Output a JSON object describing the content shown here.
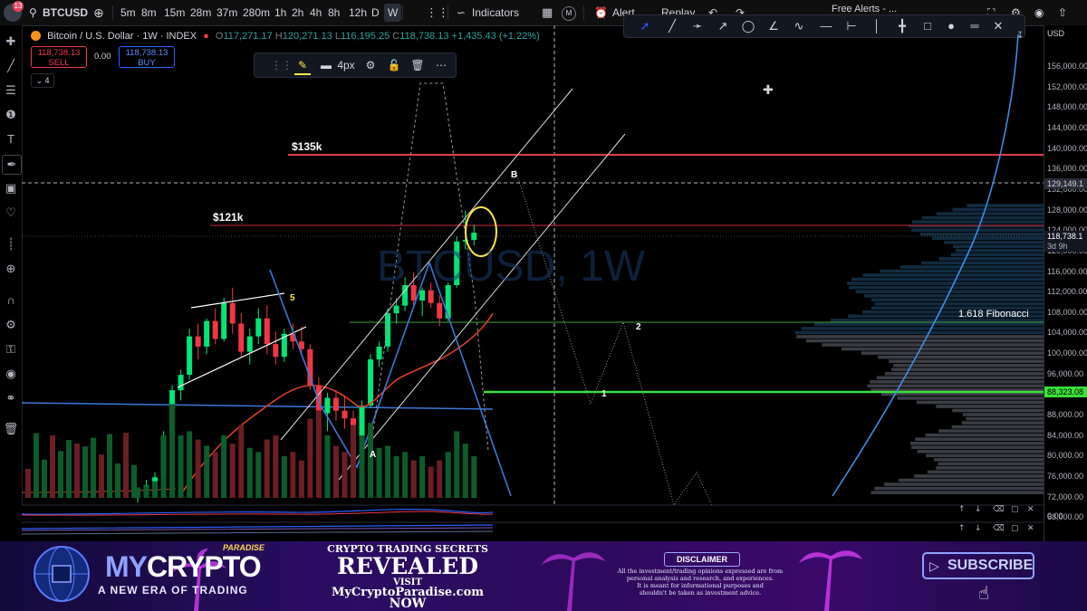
{
  "topbar": {
    "notif_count": "13",
    "symbol": "BTCUSD",
    "intervals": [
      "5m",
      "8m",
      "15m",
      "28m",
      "37m",
      "280m",
      "1h",
      "2h",
      "4h",
      "8h",
      "12h",
      "D",
      "W"
    ],
    "active_interval": "W",
    "indicators_label": "Indicators",
    "alert_label": "Alert",
    "replay_label": "Replay",
    "free_alerts_label": "Free Alerts - ...",
    "m_badge": "M"
  },
  "legend": {
    "title": "Bitcoin / U.S. Dollar · 1W · INDEX",
    "o_label": "O",
    "o_value": "117,271.17",
    "h_label": "H",
    "h_value": "120,271.13",
    "l_label": "L",
    "l_value": "116,195.25",
    "c_label": "C",
    "c_value": "118,738.13",
    "change": "+1,435.43 (+1.22%)"
  },
  "trade": {
    "sell_price": "118,738.13",
    "sell_label": "SELL",
    "spread": "0.00",
    "buy_price": "118,738.13",
    "buy_label": "BUY"
  },
  "collapse_count": "4",
  "linebar": {
    "width_label": "4px"
  },
  "watermark": "BTCUSD, 1W",
  "annotations": {
    "level_135": "$135k",
    "level_121": "$121k",
    "fib": "1.618 Fibonacci",
    "wave_5": "5",
    "wave_a": "A",
    "wave_b": "B",
    "wave_1": "1",
    "wave_2": "2"
  },
  "price_axis": {
    "currency": "USD",
    "ticks": [
      "156,000.00",
      "152,000.00",
      "148,000.00",
      "144,000.00",
      "140,000.00",
      "136,000.00",
      "132,000.00",
      "128,000.00",
      "124,000.00",
      "120,000.00",
      "116,000.00",
      "112,000.00",
      "108,000.00",
      "104,000.00",
      "100,000.00",
      "96,000.00",
      "92,000.00",
      "88,000.00",
      "84,000.00",
      "80,000.00",
      "76,000.00",
      "72,000.00",
      "68,000.00"
    ],
    "tag_129": "129,149.1",
    "tag_current": "118,738.1",
    "tag_countdown": "3d 9h",
    "tag_88": "88,323.08",
    "osc_zero": "0.00"
  },
  "banner": {
    "brand_top": "PARADISE",
    "brand_my": "MY",
    "brand_crypto": "CRYPTO",
    "brand_sub": "A NEW ERA OF TRADING",
    "secrets": "CRYPTO TRADING SECRETS",
    "revealed": "REVEALED",
    "visit": "VISIT",
    "site": "MyCryptoParadise.com",
    "now": "NOW",
    "disclaimer_title": "DISCLAIMER",
    "disclaimer_l1": "All the investment/trading opinions expressed are from",
    "disclaimer_l2": "personal analysis and research, and experiences.",
    "disclaimer_l3": "It is meant for informational purposes and",
    "disclaimer_l4": "shouldn't be taken as investment advice.",
    "subscribe": "SUBSCRIBE"
  },
  "colors": {
    "up": "#00e676",
    "down": "#f23645",
    "accent": "#2962ff",
    "brand_orange": "#f7931a"
  }
}
